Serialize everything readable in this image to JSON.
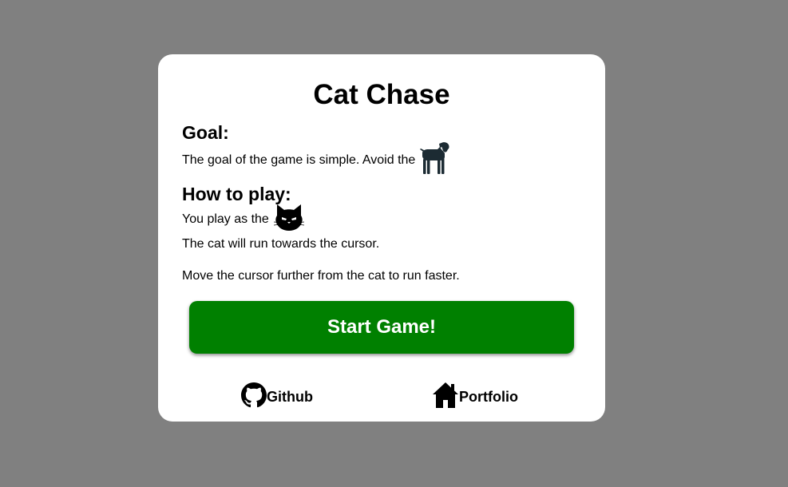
{
  "title": "Cat Chase",
  "goal": {
    "heading": "Goal:",
    "text": "The goal of the game is simple. Avoid the",
    "icon": "dog-icon"
  },
  "how_to_play": {
    "heading": "How to play:",
    "intro": "You play as the",
    "icon": "cat-icon",
    "line1": "The cat will run towards the cursor.",
    "line2": "Move the cursor further from the cat to run faster."
  },
  "start_button": {
    "label": "Start Game!",
    "color": "#008000"
  },
  "links": {
    "github": {
      "label": "Github",
      "icon": "github-icon"
    },
    "portfolio": {
      "label": "Portfolio",
      "icon": "home-icon"
    }
  },
  "colors": {
    "background": "#808080",
    "card": "#ffffff"
  }
}
